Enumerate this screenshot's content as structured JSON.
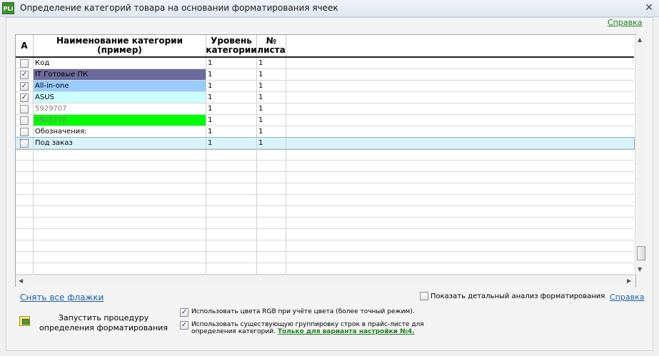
{
  "window": {
    "title": "Определение категорий товара на основании форматирования ячеек",
    "app_icon": "PLi",
    "close_glyph": "✕"
  },
  "help_top": "Справка",
  "table": {
    "columns": [
      "A",
      "Наименование категории (пример)",
      "Уровень категории",
      "№ листа"
    ],
    "rows": [
      {
        "checked": false,
        "name": "Код",
        "level": "1",
        "sheet": "1",
        "bg": "#ffffff",
        "fg": "#000000"
      },
      {
        "checked": true,
        "name": "IT Готовые ПК",
        "level": "1",
        "sheet": "1",
        "bg": "#6d6a9c",
        "fg": "#000000"
      },
      {
        "checked": true,
        "name": "All-in-one",
        "level": "1",
        "sheet": "1",
        "bg": "#99ccff",
        "fg": "#000000"
      },
      {
        "checked": true,
        "name": "ASUS",
        "level": "1",
        "sheet": "1",
        "bg": "#ccffff",
        "fg": "#000000"
      },
      {
        "checked": false,
        "name": "5929707",
        "level": "1",
        "sheet": "1",
        "bg": "#ffffff",
        "fg": "#808080"
      },
      {
        "checked": false,
        "name": "5925778",
        "level": "1",
        "sheet": "1",
        "bg": "#00ff00",
        "fg": "#808080"
      },
      {
        "checked": false,
        "name": "Обозначения:",
        "level": "1",
        "sheet": "1",
        "bg": "#ffffff",
        "fg": "#000000"
      },
      {
        "checked": false,
        "name": "Под заказ",
        "level": "1",
        "sheet": "1",
        "bg": "transparent",
        "fg": "#000000",
        "selected": true
      }
    ],
    "empty_rows": 12
  },
  "bottom": {
    "uncheck_all": "Снять все флажки",
    "detail_analysis": {
      "label": "Показать детальный анализ форматирования",
      "checked": false
    },
    "help": "Справка",
    "run_button": "Запустить процедуру определения форматирования",
    "use_rgb": {
      "label": "Использовать цвета RGB при учёте цвета (более точный режим).",
      "checked": true
    },
    "use_grouping": {
      "label": "Использовать существующую группировку строк в прайс-листе для определения категорий.",
      "link": "Только для варианта настройки №4.",
      "checked": true
    }
  }
}
